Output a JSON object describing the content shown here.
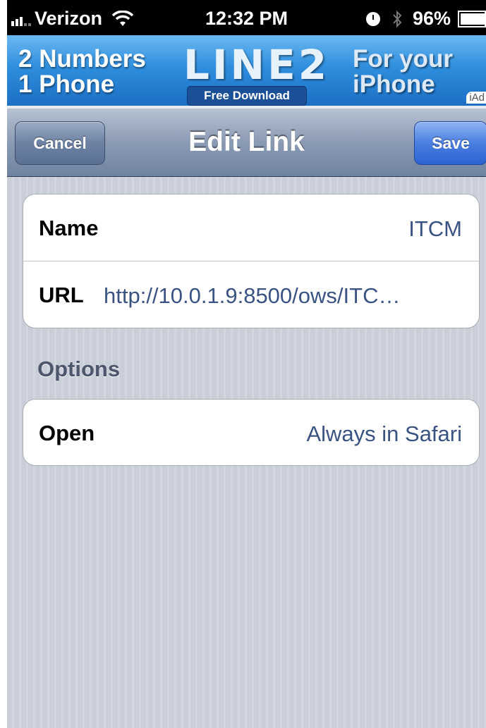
{
  "status_bar": {
    "carrier": "Verizon",
    "time": "12:32 PM",
    "battery": "96%"
  },
  "ad": {
    "line1": "2 Numbers",
    "line2": "1 Phone",
    "logo": "LINE2",
    "download": "Free Download",
    "right_line1": "For your",
    "right_line2": "iPhone",
    "badge": "iAd"
  },
  "navbar": {
    "title": "Edit Link",
    "cancel_label": "Cancel",
    "save_label": "Save"
  },
  "link_group": {
    "name_label": "Name",
    "name_value": "ITCM",
    "url_label": "URL",
    "url_value": "http://10.0.1.9:8500/ows/ITC…"
  },
  "options": {
    "header": "Options",
    "open_label": "Open",
    "open_value": "Always in Safari"
  },
  "colors": {
    "nav_tint": "#6f82a0",
    "save_button": "#3a6fdc",
    "value_text": "#3a5383",
    "background_stripes": "#c9ced8"
  }
}
